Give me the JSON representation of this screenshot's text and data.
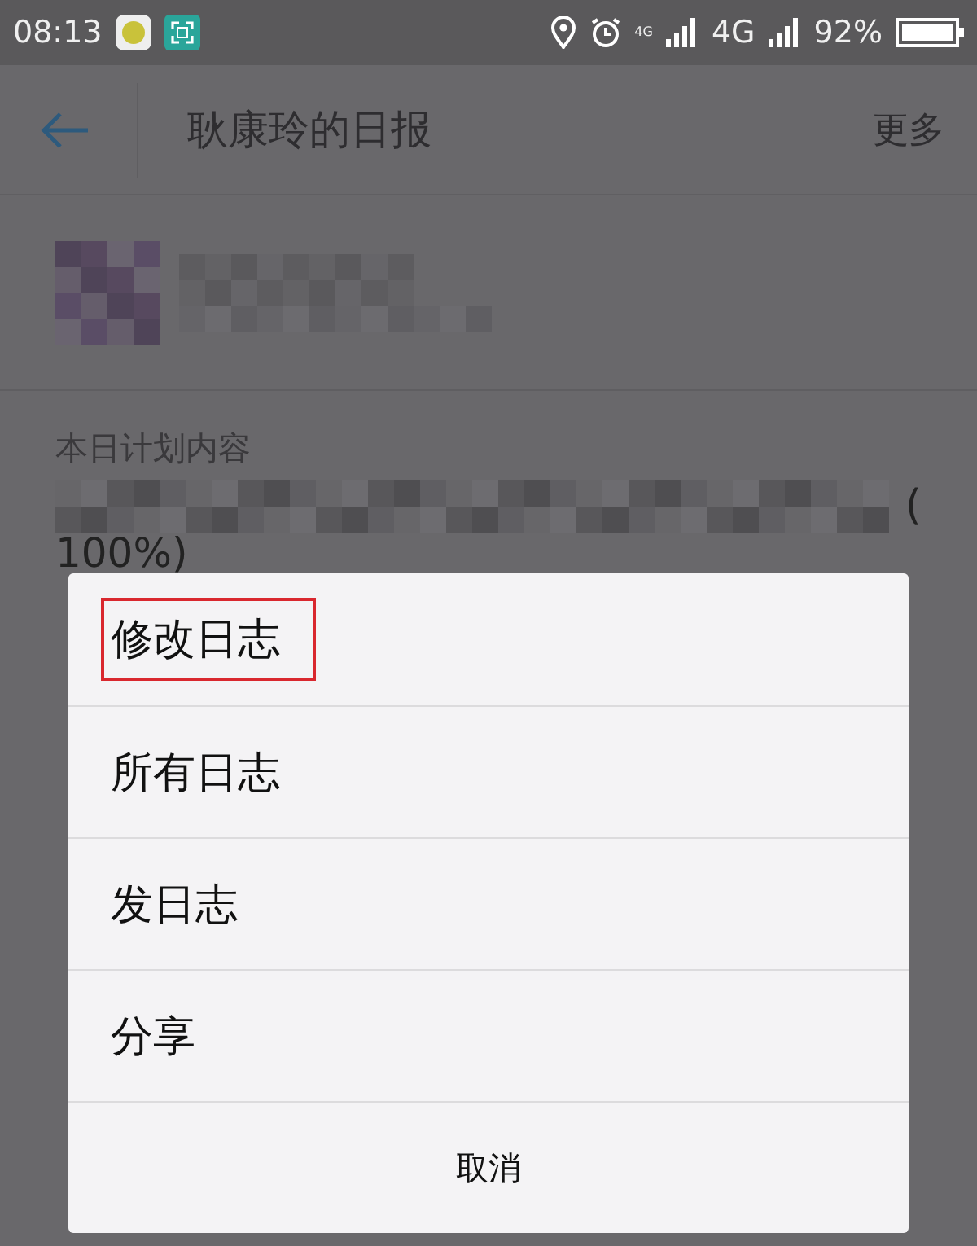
{
  "status_bar": {
    "time": "08:13",
    "network_small": "4G",
    "network": "4G",
    "battery": "92%"
  },
  "app_bar": {
    "title": "耿康玲的日报",
    "more": "更多"
  },
  "content": {
    "section_label": "本日计划内容",
    "line_end": "(",
    "line_2": "100%)"
  },
  "dialog": {
    "items": [
      {
        "label": "修改日志",
        "kind": "option",
        "highlighted": true
      },
      {
        "label": "所有日志",
        "kind": "option",
        "highlighted": false
      },
      {
        "label": "发日志",
        "kind": "option",
        "highlighted": false
      },
      {
        "label": "分享",
        "kind": "option",
        "highlighted": false
      },
      {
        "label": "取消",
        "kind": "cancel",
        "highlighted": false
      }
    ]
  }
}
